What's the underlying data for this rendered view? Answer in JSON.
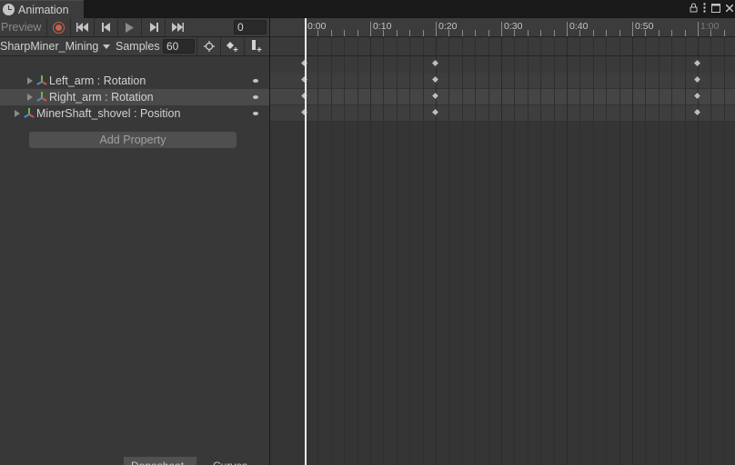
{
  "window": {
    "tab_title": "Animation",
    "icons": [
      "lock-icon",
      "kebab-menu-icon",
      "maximize-icon",
      "close-icon"
    ]
  },
  "controls": {
    "preview_label": "Preview",
    "frame_value": "0",
    "buttons": [
      "record-button",
      "first-key-button",
      "prev-key-button",
      "play-button",
      "next-key-button",
      "last-key-button"
    ]
  },
  "clip": {
    "name": "SharpMiner_Mining",
    "samples_label": "Samples",
    "samples_value": "60"
  },
  "properties": [
    {
      "label": "Left_arm : Rotation",
      "selected": false
    },
    {
      "label": "Right_arm : Rotation",
      "selected": true
    },
    {
      "label": "MinerShaft_shovel : Position",
      "selected": false
    }
  ],
  "add_property_label": "Add Property",
  "bottom_tabs": [
    "Dopesheet",
    "Curves"
  ],
  "timeline": {
    "labels": [
      "0:00",
      "0:10",
      "0:20",
      "0:30",
      "0:40",
      "0:50",
      "1:00"
    ],
    "keyframe_seconds": [
      0,
      20,
      60
    ]
  }
}
